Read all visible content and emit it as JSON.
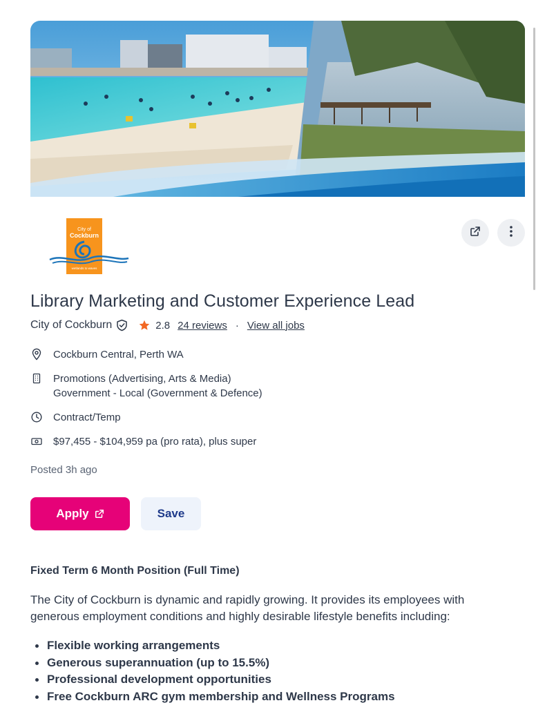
{
  "job": {
    "title": "Library Marketing and Customer Experience Lead",
    "company": "City of Cockburn",
    "rating": "2.8",
    "reviews_link": "24 reviews",
    "separator": "·",
    "view_all_jobs": "View all jobs",
    "location": "Cockburn Central, Perth WA",
    "classification_line1": "Promotions (Advertising, Arts & Media)",
    "classification_line2": "Government - Local (Government & Defence)",
    "work_type": "Contract/Temp",
    "salary": "$97,455 - $104,959 pa (pro rata), plus super",
    "posted": "Posted 3h ago"
  },
  "logo": {
    "text_top": "City of",
    "text_main": "Cockburn",
    "tagline": "wetlands to waves"
  },
  "actions": {
    "apply_label": "Apply",
    "save_label": "Save"
  },
  "description": {
    "heading": "Fixed Term 6 Month Position (Full Time)",
    "intro": "The City of Cockburn is dynamic and rapidly growing. It provides its employees with generous employment conditions and highly desirable lifestyle benefits including:",
    "benefits": [
      "Flexible working arrangements",
      "Generous superannuation (up to 15.5%)",
      "Professional development opportunities",
      "Free Cockburn ARC gym membership and Wellness Programs"
    ]
  },
  "icons": {
    "location": "location-pin-icon",
    "classification": "building-icon",
    "work_type": "clock-icon",
    "salary": "money-icon",
    "share": "external-link-icon",
    "more": "more-vertical-icon",
    "verified": "shield-check-icon",
    "rating": "star-icon"
  },
  "colors": {
    "apply_bg": "#e60278",
    "save_bg": "#eef3fb",
    "save_text": "#1e3a8a",
    "star": "#f26722",
    "text": "#2e3849",
    "logo_bg": "#f7941d"
  }
}
